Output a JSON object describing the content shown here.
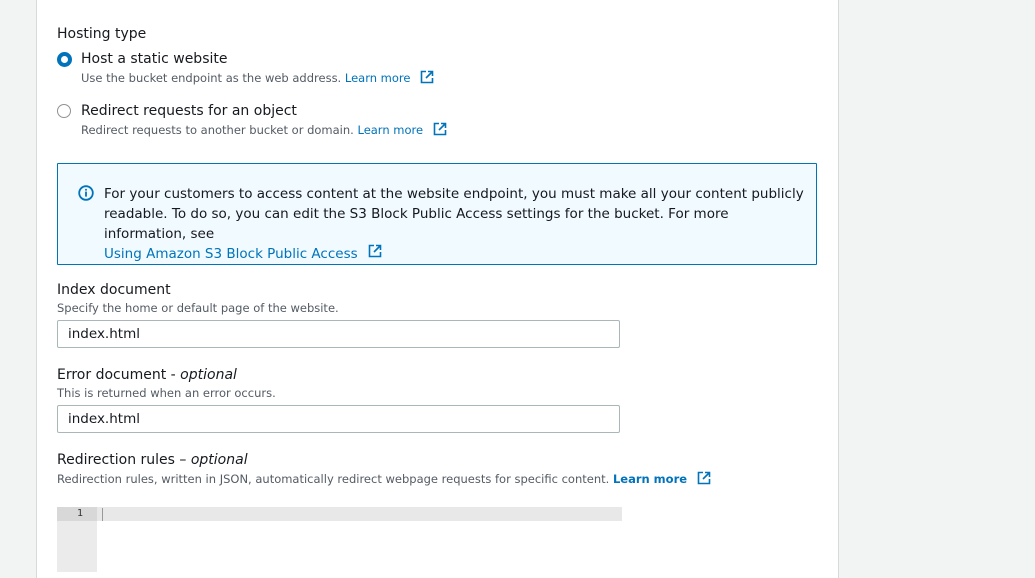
{
  "hosting": {
    "label": "Hosting type",
    "options": [
      {
        "label": "Host a static website",
        "description": "Use the bucket endpoint as the web address.",
        "link": "Learn more",
        "selected": true
      },
      {
        "label": "Redirect requests for an object",
        "description": "Redirect requests to another bucket or domain.",
        "link": "Learn more",
        "selected": false
      }
    ]
  },
  "info": {
    "text": "For your customers to access content at the website endpoint, you must make all your content publicly readable. To do so, you can edit the S3 Block Public Access settings for the bucket. For more information, see",
    "link": "Using Amazon S3 Block Public Access"
  },
  "index_document": {
    "label": "Index document",
    "description": "Specify the home or default page of the website.",
    "value": "index.html"
  },
  "error_document": {
    "label": "Error document -",
    "optional": "optional",
    "description": "This is returned when an error occurs.",
    "value": "index.html"
  },
  "redirection_rules": {
    "label": "Redirection rules –",
    "optional": "optional",
    "description": "Redirection rules, written in JSON, automatically redirect webpage requests for specific content.",
    "link": "Learn more",
    "line_number": "1"
  },
  "colors": {
    "accent": "#0073bb",
    "info_background": "#f1faff",
    "text": "#16191f",
    "secondary_text": "#545b64"
  }
}
